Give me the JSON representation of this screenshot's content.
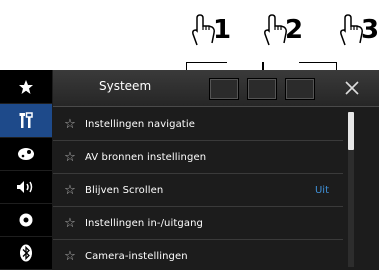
{
  "callouts": [
    "1",
    "2",
    "3"
  ],
  "header": {
    "title": "Systeem",
    "close_icon": "close-icon"
  },
  "sidebar": {
    "items": [
      {
        "icon": "star-icon"
      },
      {
        "icon": "settings-tools-icon",
        "active": true
      },
      {
        "icon": "theme-palette-icon"
      },
      {
        "icon": "speaker-audio-icon"
      },
      {
        "icon": "record-circle-icon"
      },
      {
        "icon": "bluetooth-icon"
      }
    ]
  },
  "menu": {
    "items": [
      {
        "label": "Instellingen navigatie",
        "value": ""
      },
      {
        "label": "AV bronnen instellingen",
        "value": ""
      },
      {
        "label": "Blijven Scrollen",
        "value": "Uit"
      },
      {
        "label": "Instellingen in-/uitgang",
        "value": ""
      },
      {
        "label": "Camera-instellingen",
        "value": ""
      }
    ]
  },
  "colors": {
    "accent": "#3f8fd6",
    "active_sidebar": "#1e4a8a",
    "background": "#1c1c1c"
  }
}
